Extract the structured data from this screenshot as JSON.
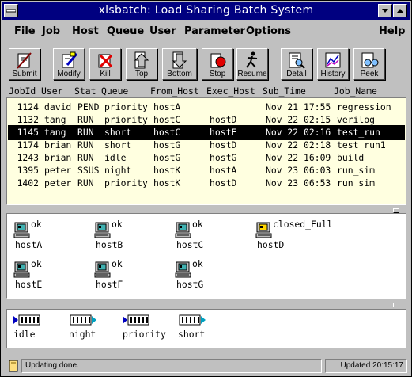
{
  "window": {
    "title": "xlsbatch: Load Sharing Batch System"
  },
  "menu": {
    "items": [
      "File",
      "Job",
      "Host",
      "Queue",
      "User",
      "Parameter",
      "Options",
      "Help"
    ]
  },
  "toolbar": {
    "buttons": [
      "Submit",
      "Modify",
      "Kill",
      "Top",
      "Bottom",
      "Stop",
      "Resume",
      "Detail",
      "History",
      "Peek"
    ]
  },
  "jobs": {
    "columns": [
      "JobId",
      "User",
      "Stat",
      "Queue",
      "From_Host",
      "Exec_Host",
      "Sub_Time",
      "Job_Name"
    ],
    "rows": [
      {
        "jobid": "1124",
        "user": "david",
        "stat": "PEND",
        "queue": "priority",
        "from": "hostA",
        "exec": "",
        "time": "Nov 21 17:55",
        "name": "regression"
      },
      {
        "jobid": "1132",
        "user": "tang",
        "stat": "RUN",
        "queue": "priority",
        "from": "hostC",
        "exec": "hostD",
        "time": "Nov 22 02:15",
        "name": "verilog"
      },
      {
        "jobid": "1145",
        "user": "tang",
        "stat": "RUN",
        "queue": "short",
        "from": "hostC",
        "exec": "hostF",
        "time": "Nov 22 02:16",
        "name": "test_run"
      },
      {
        "jobid": "1174",
        "user": "brian",
        "stat": "RUN",
        "queue": "short",
        "from": "hostG",
        "exec": "hostD",
        "time": "Nov 22 02:18",
        "name": "test_run1"
      },
      {
        "jobid": "1243",
        "user": "brian",
        "stat": "RUN",
        "queue": "idle",
        "from": "hostG",
        "exec": "hostG",
        "time": "Nov 22 16:09",
        "name": "build"
      },
      {
        "jobid": "1395",
        "user": "peter",
        "stat": "SSUS",
        "queue": "night",
        "from": "hostK",
        "exec": "hostA",
        "time": "Nov 23 06:03",
        "name": "run_sim"
      },
      {
        "jobid": "1402",
        "user": "peter",
        "stat": "RUN",
        "queue": "priority",
        "from": "hostK",
        "exec": "hostD",
        "time": "Nov 23 06:53",
        "name": "run_sim"
      }
    ],
    "selected_index": 2
  },
  "hosts": [
    {
      "name": "hostA",
      "status": "ok"
    },
    {
      "name": "hostB",
      "status": "ok"
    },
    {
      "name": "hostC",
      "status": "ok"
    },
    {
      "name": "hostD",
      "status": "closed_Full"
    },
    {
      "name": "hostE",
      "status": "ok"
    },
    {
      "name": "hostF",
      "status": "ok"
    },
    {
      "name": "hostG",
      "status": "ok"
    }
  ],
  "queues": [
    {
      "name": "idle"
    },
    {
      "name": "night"
    },
    {
      "name": "priority"
    },
    {
      "name": "short"
    }
  ],
  "status": {
    "message": "Updating done.",
    "updated": "Updated 20:15:17"
  },
  "colors": {
    "title_bar": "#000080",
    "jobs_background": "#ffffe0",
    "selection": "#000000",
    "host_closed": "#ffd700"
  }
}
